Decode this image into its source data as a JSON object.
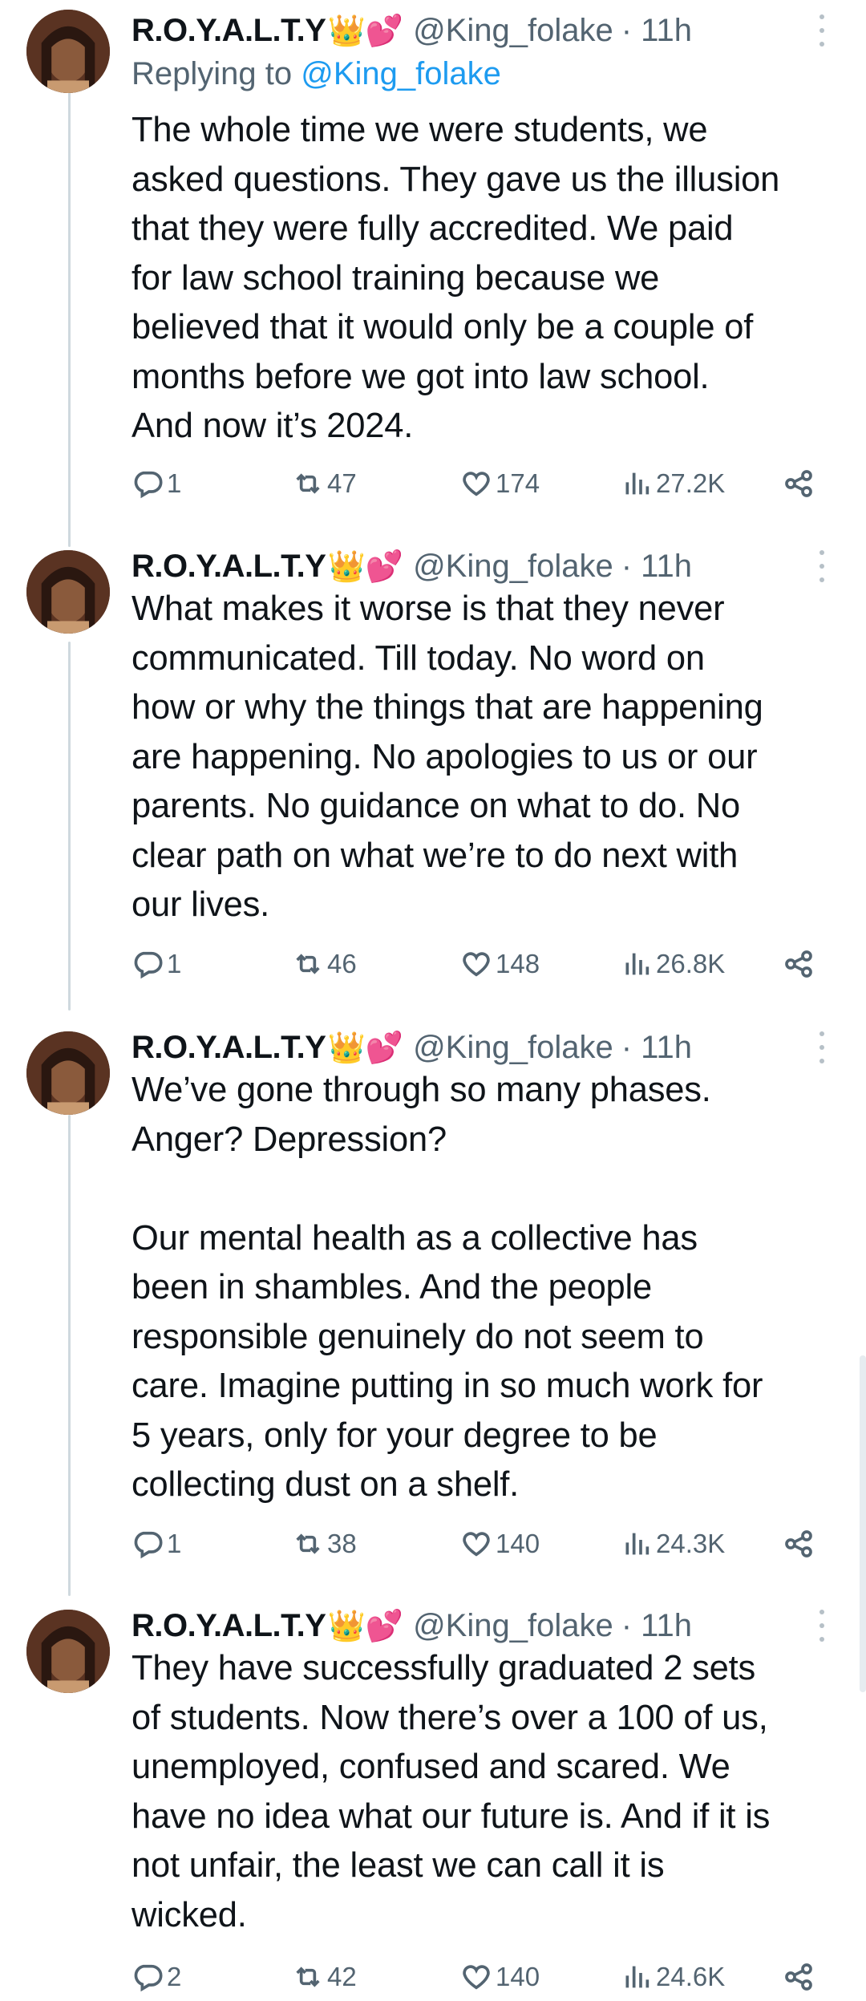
{
  "author": {
    "display_name": "R.O.Y.A.L.T.Y",
    "name_emojis": "👑💕",
    "handle": "@King_folake"
  },
  "tweets": [
    {
      "time": "· 11h",
      "replying_label": "Replying to ",
      "replying_handle": "@King_folake",
      "text": "The whole time we were students, we\nasked questions. They gave us the illusion\nthat they were fully accredited. We paid\nfor law school training because we\nbelieved that it would only be a couple of\nmonths before we got into law school.\nAnd now it’s 2024.",
      "replies": "1",
      "retweets": "47",
      "likes": "174",
      "views": "27.2K"
    },
    {
      "time": "· 11h",
      "text": "What makes it worse is that they never\ncommunicated. Till today. No word on\nhow or why the things that are happening\nare happening. No apologies to us or our\nparents. No guidance on what to do. No\nclear path  on what we’re to do next with\nour lives.",
      "replies": "1",
      "retweets": "46",
      "likes": "148",
      "views": "26.8K"
    },
    {
      "time": "· 11h",
      "text": "We’ve gone through so many phases.\nAnger? Depression?\n\nOur mental health as a collective has\nbeen in shambles. And the people\nresponsible genuinely do not seem to\ncare. Imagine putting in so much work for\n5 years, only for your degree to be\ncollecting dust on a shelf.",
      "replies": "1",
      "retweets": "38",
      "likes": "140",
      "views": "24.3K"
    },
    {
      "time": "· 11h",
      "text": "They have successfully graduated 2 sets\nof students. Now there’s over a 100 of us,\nunemployed, confused and scared. We\nhave no idea what our future is. And if it is\nnot unfair, the least we can call it is\nwicked.",
      "replies": "2",
      "retweets": "42",
      "likes": "140",
      "views": "24.6K"
    }
  ],
  "icons": {
    "reply": "speech-bubble-icon",
    "retweet": "retweet-arrows-icon",
    "like": "heart-icon",
    "views": "bar-chart-icon",
    "share": "share-nodes-icon",
    "more": "vertical-dots-icon"
  },
  "colors": {
    "text": "#0f1419",
    "secondary": "#536471",
    "link": "#1d9bf0",
    "thread_line": "#cfd9de"
  }
}
